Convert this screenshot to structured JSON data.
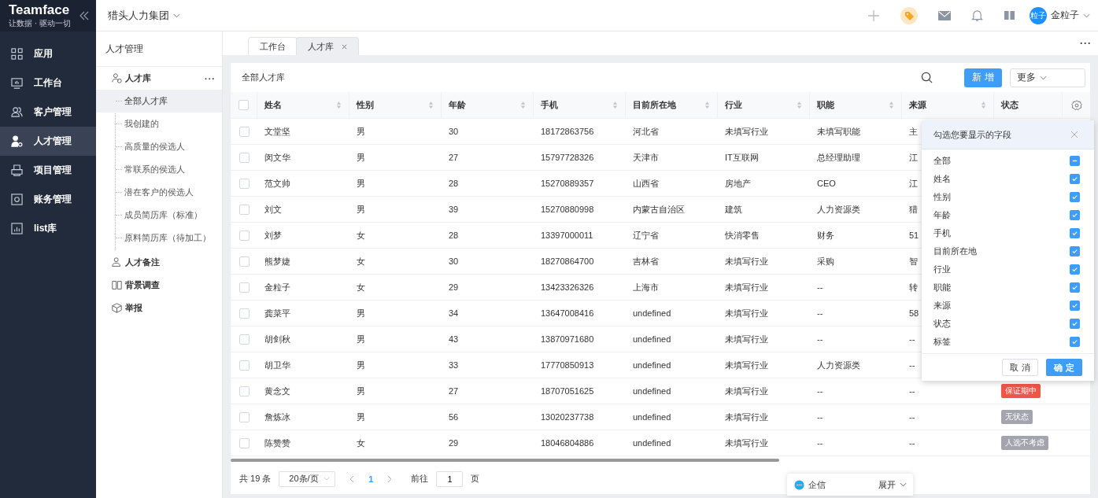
{
  "brand": {
    "name": "Teamface",
    "slogan": "让数据 · 驱动一切"
  },
  "company": "猎头人力集团",
  "user": {
    "avatar": "粒子",
    "name": "金粒子"
  },
  "nav": [
    {
      "label": "应用",
      "selected": false
    },
    {
      "label": "工作台",
      "selected": false
    },
    {
      "label": "客户管理",
      "selected": false
    },
    {
      "label": "人才管理",
      "selected": true
    },
    {
      "label": "项目管理",
      "selected": false
    },
    {
      "label": "账务管理",
      "selected": false
    },
    {
      "label": "list库",
      "selected": false
    }
  ],
  "module_title": "人才管理",
  "tree": [
    {
      "label": "人才库",
      "more": "···",
      "expanded": true,
      "children": [
        {
          "label": "全部人才库",
          "selected": true
        },
        {
          "label": "我创建的",
          "selected": false
        },
        {
          "label": "高质量的侯选人",
          "selected": false
        },
        {
          "label": "常联系的侯选人",
          "selected": false
        },
        {
          "label": "潜在客户的侯选人",
          "selected": false
        },
        {
          "label": "成员简历库（标准）",
          "selected": false
        },
        {
          "label": "原料简历库（待加工）",
          "selected": false
        }
      ]
    },
    {
      "label": "人才备注",
      "expanded": false
    },
    {
      "label": "背景调查",
      "expanded": false
    },
    {
      "label": "举报",
      "expanded": false
    }
  ],
  "tabs": [
    {
      "label": "工作台",
      "selected": false,
      "closable": false
    },
    {
      "label": "人才库",
      "selected": true,
      "closable": true
    }
  ],
  "tab_more": "···",
  "view_title": "全部人才库",
  "buttons": {
    "add": "新 增",
    "more": "更多"
  },
  "table": {
    "all_checked": false,
    "columns": [
      {
        "label": "姓名",
        "sortable": true
      },
      {
        "label": "性别",
        "sortable": true
      },
      {
        "label": "年龄",
        "sortable": true
      },
      {
        "label": "手机",
        "sortable": true
      },
      {
        "label": "目前所在地",
        "sortable": true
      },
      {
        "label": "行业",
        "sortable": true
      },
      {
        "label": "职能",
        "sortable": true
      },
      {
        "label": "来源",
        "sortable": true
      },
      {
        "label": "状态",
        "sortable": false
      }
    ],
    "rows": [
      {
        "checked": false,
        "cells": [
          "文堂坚",
          "男",
          "30",
          "18172863756",
          "河北省",
          "未填写行业",
          "未填写职能",
          "主"
        ]
      },
      {
        "checked": false,
        "cells": [
          "闵文华",
          "男",
          "27",
          "15797728326",
          "天津市",
          "IT互联网",
          "总经理助理",
          "江"
        ]
      },
      {
        "checked": false,
        "cells": [
          "范文帅",
          "男",
          "28",
          "15270889357",
          "山西省",
          "房地产",
          "CEO",
          "江"
        ]
      },
      {
        "checked": false,
        "cells": [
          "刘文",
          "男",
          "39",
          "15270880998",
          "内蒙古自治区",
          "建筑",
          "人力资源类",
          "猎"
        ]
      },
      {
        "checked": false,
        "cells": [
          "刘梦",
          "女",
          "28",
          "13397000011",
          "辽宁省",
          "快消零售",
          "财务",
          "51"
        ]
      },
      {
        "checked": false,
        "cells": [
          "熊梦婕",
          "女",
          "30",
          "18270864700",
          "吉林省",
          "未填写行业",
          "采购",
          "智"
        ]
      },
      {
        "checked": false,
        "cells": [
          "金粒子",
          "女",
          "29",
          "13423326326",
          "上海市",
          "未填写行业",
          "--",
          "转"
        ]
      },
      {
        "checked": false,
        "cells": [
          "龚菜平",
          "男",
          "34",
          "13647008416",
          "undefined",
          "未填写行业",
          "--",
          "58"
        ]
      },
      {
        "checked": false,
        "cells": [
          "胡剑秋",
          "男",
          "43",
          "13870971680",
          "undefined",
          "未填写行业",
          "--",
          "--"
        ]
      },
      {
        "checked": false,
        "cells": [
          "胡卫华",
          "男",
          "33",
          "17770850913",
          "undefined",
          "未填写行业",
          "人力资源类",
          "--"
        ]
      },
      {
        "checked": false,
        "cells": [
          "黄念文",
          "男",
          "27",
          "18707051625",
          "undefined",
          "未填写行业",
          "--",
          "--"
        ],
        "status": {
          "label": "保证期中",
          "color": "#f0554a"
        }
      },
      {
        "checked": false,
        "cells": [
          "詹炼冰",
          "男",
          "56",
          "13020237738",
          "undefined",
          "未填写行业",
          "--",
          "--"
        ],
        "status": {
          "label": "无状态",
          "color": "#a4a4ae"
        }
      },
      {
        "checked": false,
        "cells": [
          "陈赞赞",
          "女",
          "29",
          "18046804886",
          "undefined",
          "未填写行业",
          "--",
          "--"
        ],
        "status": {
          "label": "人选不考虑",
          "color": "#a4a4ae"
        }
      }
    ]
  },
  "pagination": {
    "total": "共 19 条",
    "page_size": "20条/页",
    "current": "1",
    "goto_label": "前往",
    "goto_value": "1",
    "goto_unit": "页"
  },
  "field_picker": {
    "title": "勾选您要显示的字段",
    "items": [
      {
        "label": "全部",
        "checked": true,
        "partial": true
      },
      {
        "label": "姓名",
        "checked": true
      },
      {
        "label": "性别",
        "checked": true
      },
      {
        "label": "年龄",
        "checked": true
      },
      {
        "label": "手机",
        "checked": true
      },
      {
        "label": "目前所在地",
        "checked": true
      },
      {
        "label": "行业",
        "checked": true
      },
      {
        "label": "职能",
        "checked": true
      },
      {
        "label": "来源",
        "checked": true
      },
      {
        "label": "状态",
        "checked": true
      },
      {
        "label": "标签",
        "checked": true
      }
    ],
    "cancel": "取 消",
    "ok": "确 定"
  },
  "chat": {
    "label": "企信",
    "action": "展开"
  }
}
